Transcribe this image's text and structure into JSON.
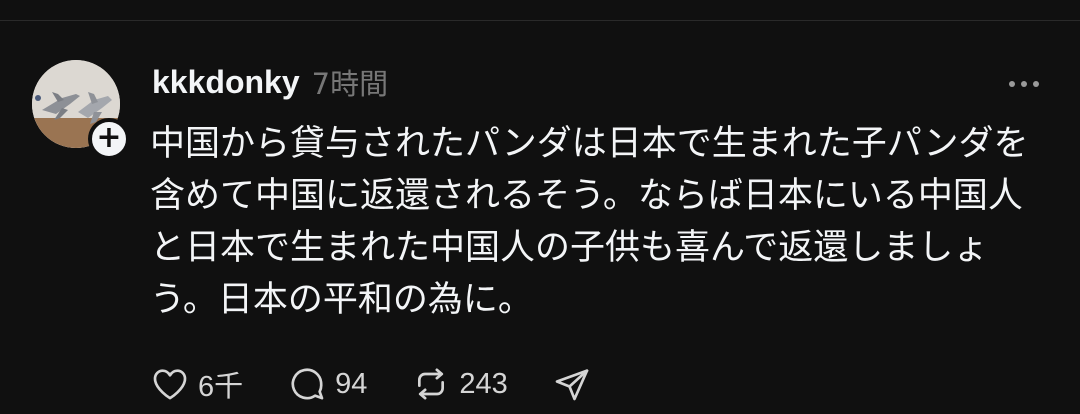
{
  "post": {
    "username": "kkkdonky",
    "timestamp": "7時間",
    "body": "中国から貸与されたパンダは日本で生まれた子パンダを含めて中国に返還されるそう。ならば日本にいる中国人と日本で生まれた中国人の子供も喜んで返還しましょう。日本の平和の為に。"
  },
  "actions": {
    "like": {
      "icon": "heart-icon",
      "count": "6千"
    },
    "reply": {
      "icon": "comment-icon",
      "count": "94"
    },
    "repost": {
      "icon": "repost-icon",
      "count": "243"
    },
    "share": {
      "icon": "send-icon"
    }
  },
  "colors": {
    "background": "#101010",
    "text": "#f3f5f7",
    "muted": "#777777"
  }
}
